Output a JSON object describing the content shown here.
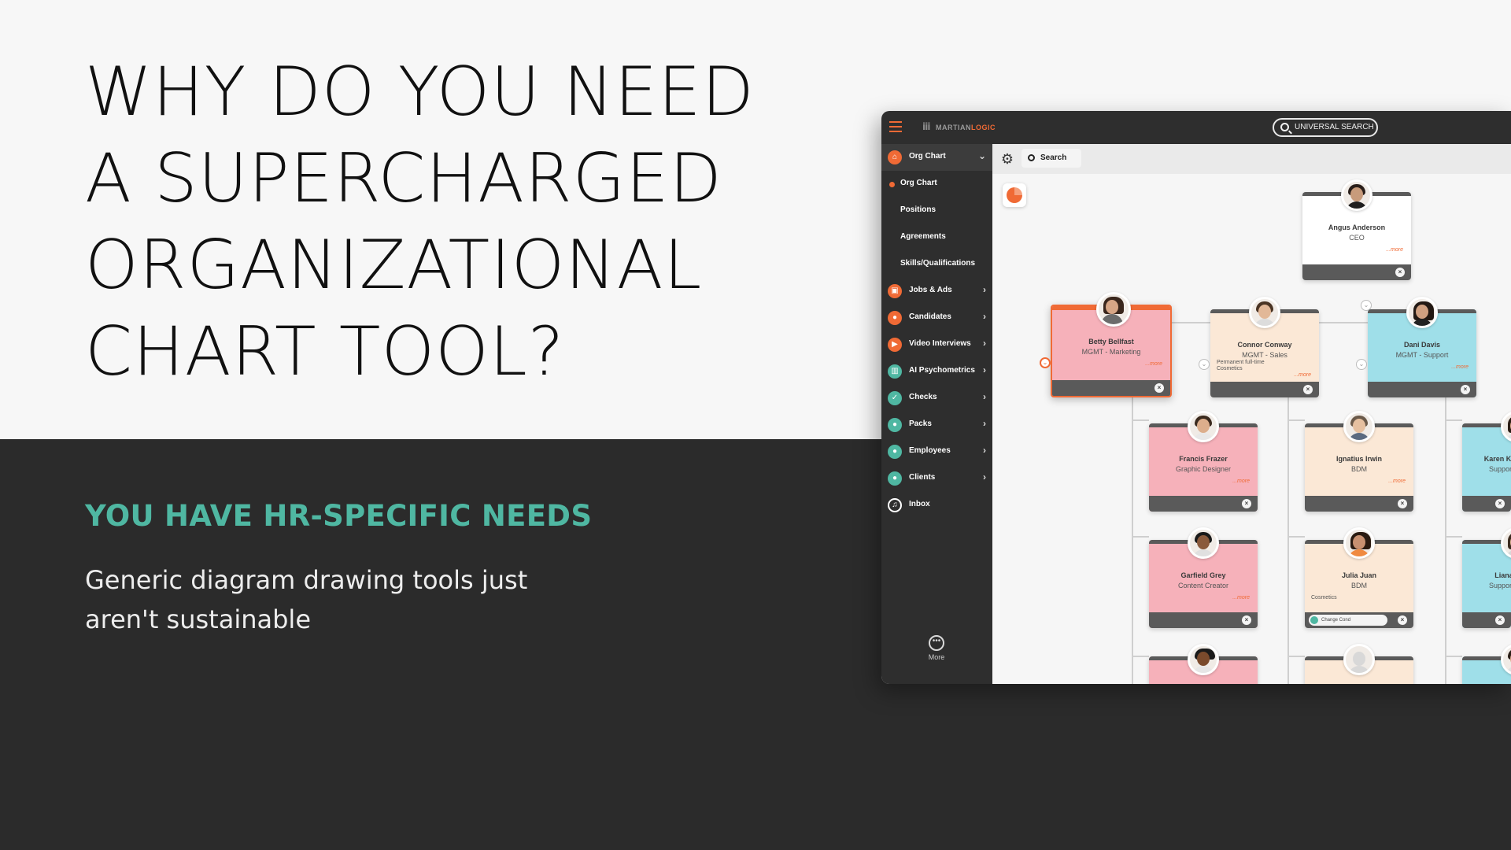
{
  "headline": [
    "WHY DO YOU NEED",
    "A SUPERCHARGED",
    "ORGANIZATIONAL",
    "CHART TOOL?"
  ],
  "subheading": "YOU HAVE HR-SPECIFIC NEEDS",
  "body": "Generic diagram drawing tools just aren't sustainable",
  "colors": {
    "accent": "#f06a35",
    "teal": "#4fb7a2",
    "dark": "#2b2b2b",
    "light": "#f7f7f7"
  },
  "app": {
    "logo": {
      "part1": "MARTIAN",
      "part2": "LOGIC"
    },
    "universal_search": "UNIVERSAL SEARCH",
    "search_label": "Search",
    "more_label": "More",
    "nav": [
      {
        "label": "Org Chart",
        "icon": "org-chart-icon",
        "color": "#f06a35"
      },
      {
        "label": "Jobs & Ads",
        "icon": "jobs-icon",
        "color": "#f06a35"
      },
      {
        "label": "Candidates",
        "icon": "candidates-icon",
        "color": "#f06a35"
      },
      {
        "label": "Video Interviews",
        "icon": "video-icon",
        "color": "#f06a35"
      },
      {
        "label": "AI Psychometrics",
        "icon": "psychometrics-icon",
        "color": "#4fb7a2"
      },
      {
        "label": "Checks",
        "icon": "checks-icon",
        "color": "#4fb7a2"
      },
      {
        "label": "Packs",
        "icon": "packs-icon",
        "color": "#4fb7a2"
      },
      {
        "label": "Employees",
        "icon": "employees-icon",
        "color": "#4fb7a2"
      },
      {
        "label": "Clients",
        "icon": "clients-icon",
        "color": "#4fb7a2"
      },
      {
        "label": "Inbox",
        "icon": "bell-icon",
        "color": "#2e2e2e"
      }
    ],
    "subnav": [
      "Org Chart",
      "Positions",
      "Agreements",
      "Skills/Qualifications"
    ],
    "more_link": "...more",
    "cards": {
      "ceo": {
        "name": "Angus Anderson",
        "role": "CEO"
      },
      "betty": {
        "name": "Betty Bellfast",
        "role": "MGMT - Marketing"
      },
      "connor": {
        "name": "Connor Conway",
        "role": "MGMT - Sales",
        "extra": "Permanent full-time\nCosmetics"
      },
      "dani": {
        "name": "Dani Davis",
        "role": "MGMT - Support"
      },
      "francis": {
        "name": "Francis Frazer",
        "role": "Graphic Designer"
      },
      "ignatius": {
        "name": "Ignatius Irwin",
        "role": "BDM"
      },
      "karen": {
        "name": "Karen Kurtzenstien",
        "role": "Support Assistant"
      },
      "garfield": {
        "name": "Garfield Grey",
        "role": "Content Creator"
      },
      "julia": {
        "name": "Julia Juan",
        "role": "BDM",
        "extra": "Cosmetics",
        "pill": "Change Cond"
      },
      "liana": {
        "name": "Liana Lesher",
        "role": "Support Assistant"
      }
    }
  }
}
